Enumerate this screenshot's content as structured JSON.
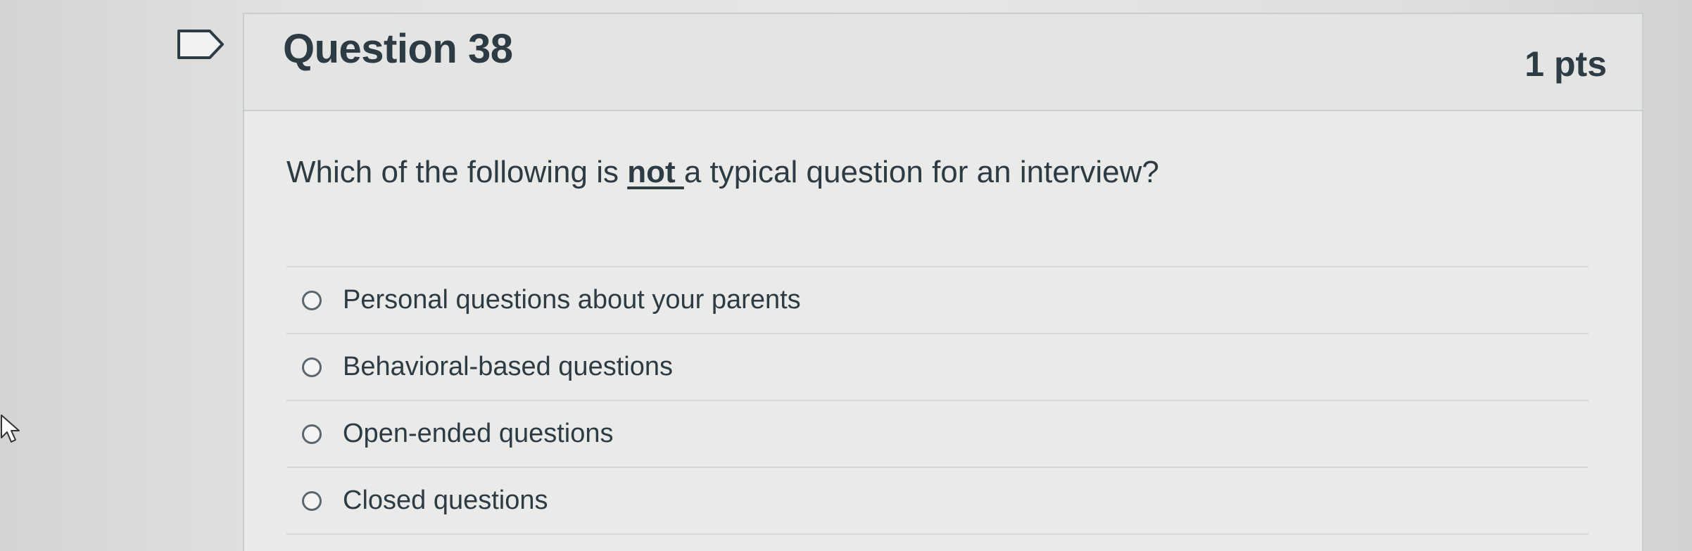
{
  "question": {
    "title": "Question 38",
    "points": "1 pts",
    "text_before": "Which of the following is ",
    "text_emphasis": "not ",
    "text_after": "a typical question for an interview?",
    "answers": [
      {
        "label": "Personal questions about your parents"
      },
      {
        "label": "Behavioral-based questions"
      },
      {
        "label": "Open-ended questions"
      },
      {
        "label": "Closed questions"
      }
    ]
  },
  "icons": {
    "flag": "flag-question-icon",
    "cursor": "mouse-cursor-icon"
  },
  "colors": {
    "text": "#2d3b45",
    "border": "#c7cdd1",
    "radio_border": "#5b6770"
  }
}
